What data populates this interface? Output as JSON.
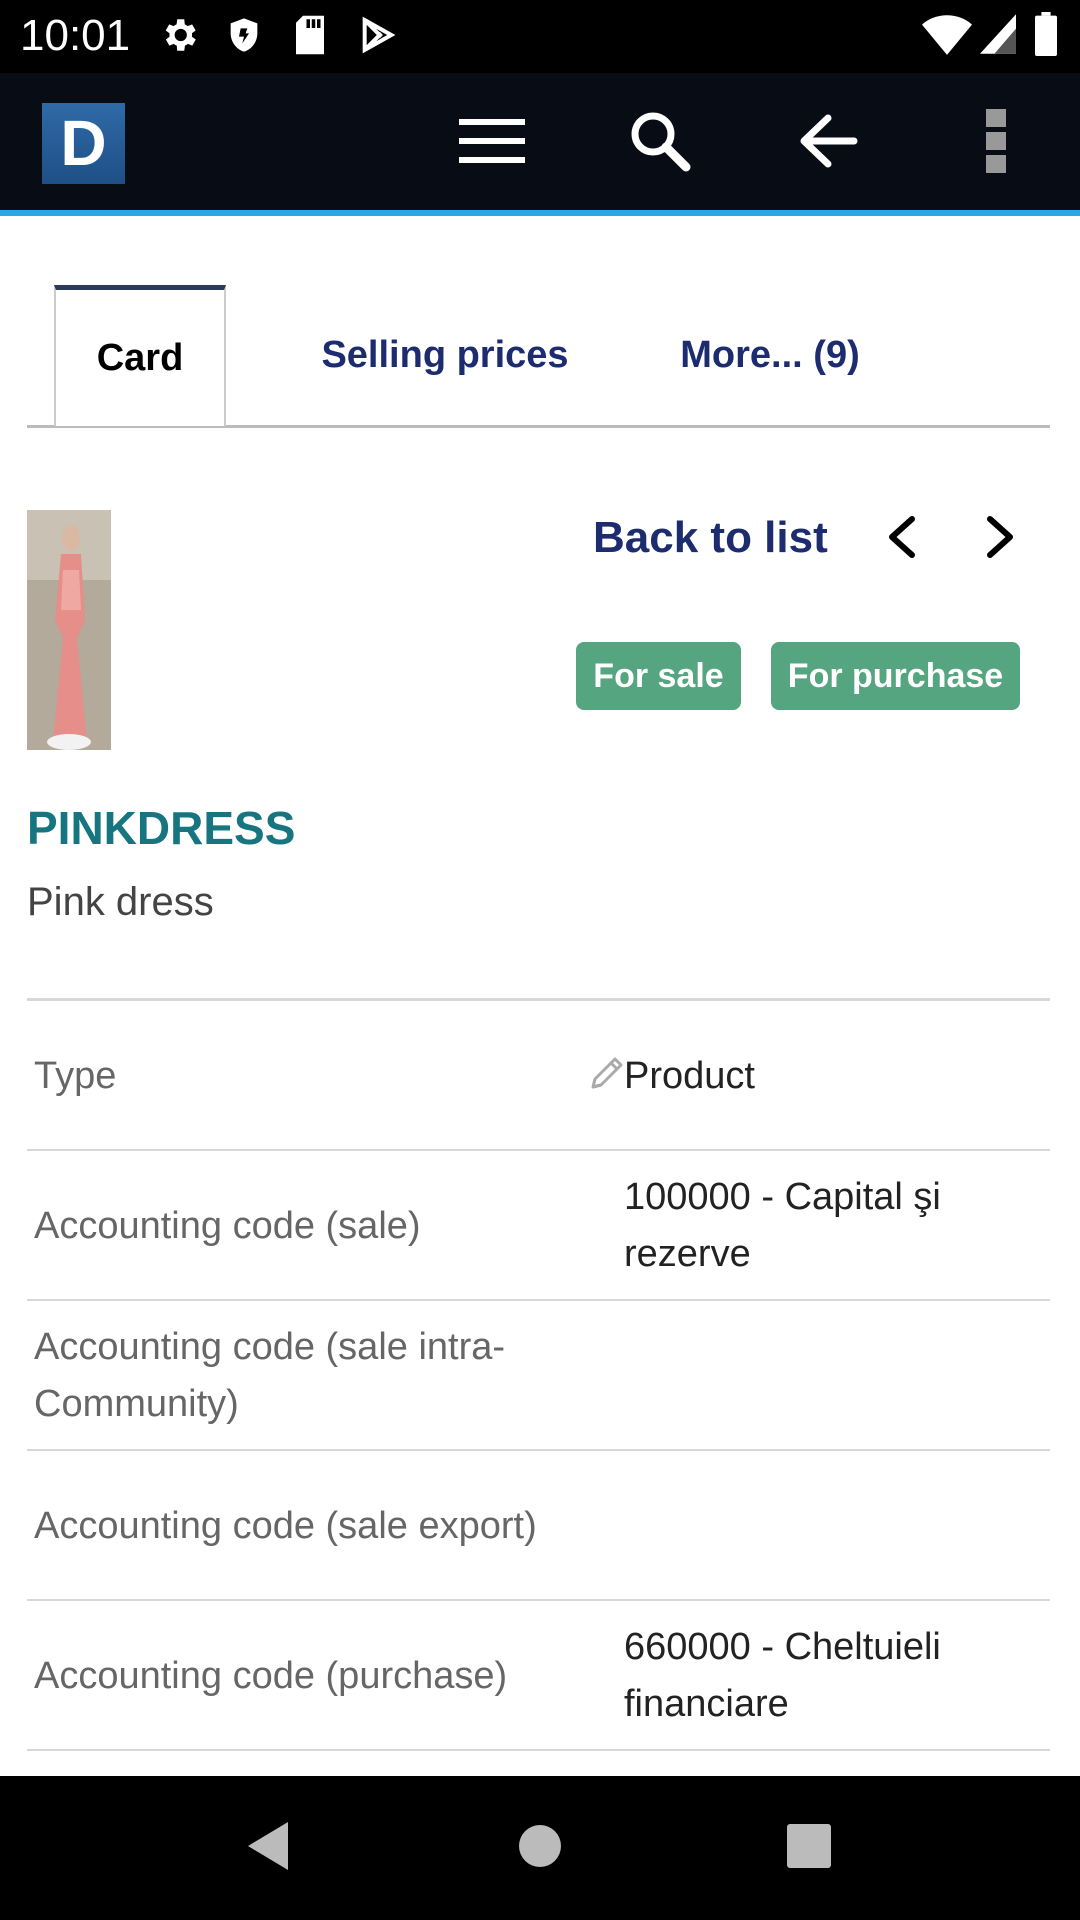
{
  "status_bar": {
    "time": "10:01",
    "left_icons": [
      "gear-icon",
      "shield-icon",
      "sd-card-icon",
      "play-store-icon"
    ],
    "right_icons": [
      "wifi-icon",
      "cell-signal-icon",
      "battery-icon"
    ]
  },
  "header": {
    "logo_letter": "D",
    "buttons": [
      "menu-icon",
      "search-icon",
      "back-arrow-icon",
      "more-vert-icon"
    ],
    "accent_color": "#2aa7e0"
  },
  "tabs": [
    {
      "label": "Card",
      "active": true
    },
    {
      "label": "Selling prices",
      "active": false
    },
    {
      "label": "More... (9)",
      "active": false
    }
  ],
  "product": {
    "back_to_list": "Back to list",
    "badges": [
      "For sale",
      "For purchase"
    ],
    "badge_color": "#55a580",
    "ref": "PINKDRESS",
    "label": "Pink dress"
  },
  "fields": [
    {
      "label": "Type",
      "value": "Product",
      "editable": true
    },
    {
      "label": "Accounting code (sale)",
      "value": "100000 - Capital şi rezerve",
      "editable": false
    },
    {
      "label": "Accounting code (sale intra-Community)",
      "value": "",
      "editable": false
    },
    {
      "label": "Accounting code (sale export)",
      "value": "",
      "editable": false
    },
    {
      "label": "Accounting code (purchase)",
      "value": "660000 - Cheltuieli financiare",
      "editable": false
    }
  ],
  "nav_bar": {
    "buttons": [
      "nav-back-icon",
      "nav-home-icon",
      "nav-recents-icon"
    ]
  }
}
